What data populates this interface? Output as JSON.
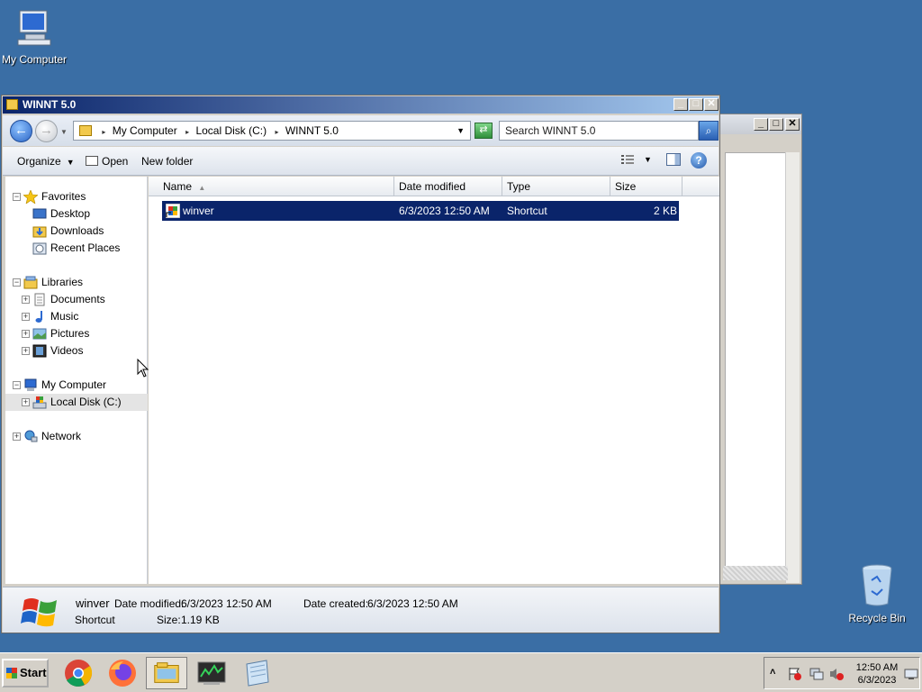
{
  "desktop": {
    "icons": [
      {
        "label": "My Computer",
        "icon": "my-computer-icon"
      },
      {
        "label": "Recycle Bin",
        "icon": "recycle-bin-icon"
      }
    ]
  },
  "window": {
    "title": "WINNT 5.0",
    "controls": {
      "minimize": "_",
      "maximize": "□",
      "close": "✕"
    }
  },
  "address": {
    "segments": [
      "My Computer",
      "Local Disk (C:)",
      "WINNT 5.0"
    ],
    "search_placeholder": "Search WINNT 5.0"
  },
  "toolbar": {
    "organize": "Organize",
    "open": "Open",
    "new_folder": "New folder"
  },
  "nav": {
    "favorites": "Favorites",
    "desktop": "Desktop",
    "downloads": "Downloads",
    "recent": "Recent Places",
    "libraries": "Libraries",
    "documents": "Documents",
    "music": "Music",
    "pictures": "Pictures",
    "videos": "Videos",
    "mycomputer": "My Computer",
    "localdisk": "Local Disk (C:)",
    "network": "Network"
  },
  "columns": {
    "name": "Name",
    "date": "Date modified",
    "type": "Type",
    "size": "Size"
  },
  "files": [
    {
      "name": "winver",
      "date": "6/3/2023 12:50 AM",
      "type": "Shortcut",
      "size": "2 KB"
    }
  ],
  "details": {
    "name": "winver",
    "type": "Shortcut",
    "date_modified_label": "Date modified:",
    "date_modified": "6/3/2023 12:50 AM",
    "date_created_label": "Date created:",
    "date_created": "6/3/2023 12:50 AM",
    "size_label": "Size:",
    "size": "1.19 KB"
  },
  "taskbar": {
    "start": "Start",
    "apps": [
      "chrome-icon",
      "firefox-icon",
      "explorer-icon",
      "task-manager-icon",
      "notepad-icon"
    ],
    "time": "12:50 AM",
    "date": "6/3/2023"
  }
}
